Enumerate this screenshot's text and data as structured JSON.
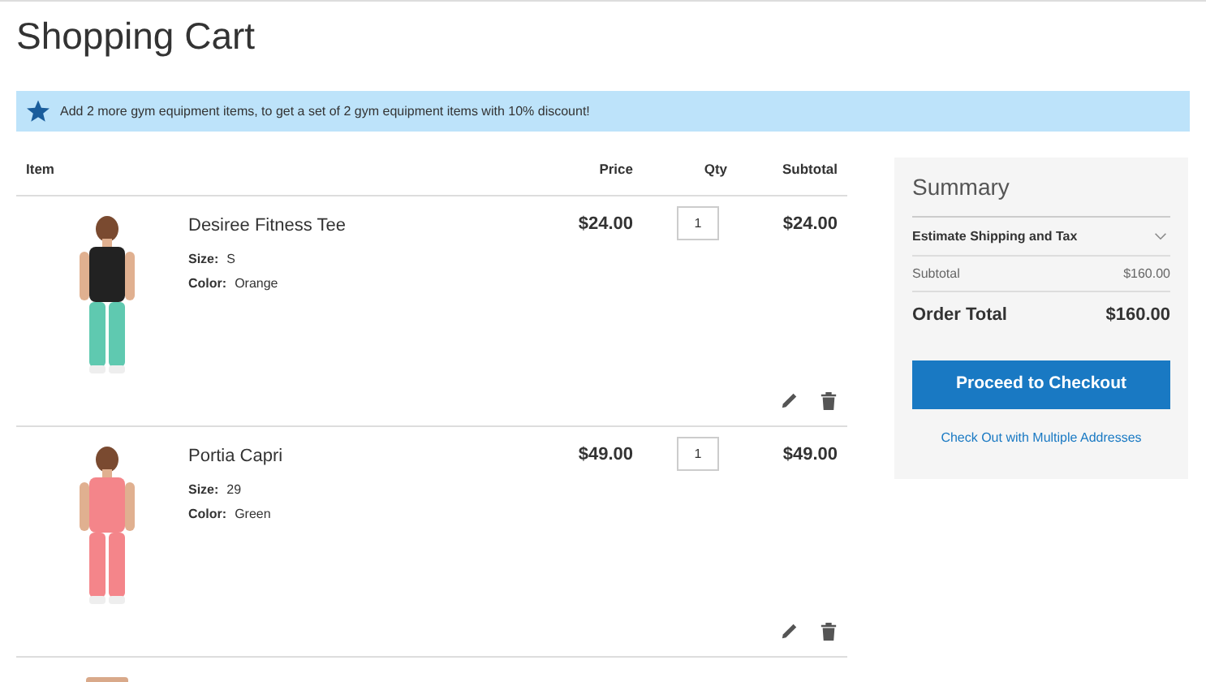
{
  "page_title": "Shopping Cart",
  "notice": {
    "text": "Add 2 more gym equipment items, to get a set of 2 gym equipment items with 10% discount!"
  },
  "table": {
    "columns": [
      "Item",
      "Price",
      "Qty",
      "Subtotal"
    ],
    "rows": [
      {
        "name": "Desiree Fitness Tee",
        "price": "$24.00",
        "qty": "1",
        "subtotal": "$24.00",
        "options": [
          {
            "label": "Size:",
            "value": "S"
          },
          {
            "label": "Color:",
            "value": "Orange"
          }
        ]
      },
      {
        "name": "Portia Capri",
        "price": "$49.00",
        "qty": "1",
        "subtotal": "$49.00",
        "options": [
          {
            "label": "Size:",
            "value": "29"
          },
          {
            "label": "Color:",
            "value": "Green"
          }
        ]
      }
    ]
  },
  "summary": {
    "title": "Summary",
    "estimate": {
      "label": "Estimate Shipping and Tax",
      "expanded": false
    },
    "subtotal": {
      "label": "Subtotal",
      "value": "$160.00"
    },
    "order_total": {
      "label": "Order Total",
      "value": "$160.00"
    },
    "checkout_button": "Proceed to Checkout",
    "multi_link": "Check Out with Multiple Addresses"
  }
}
